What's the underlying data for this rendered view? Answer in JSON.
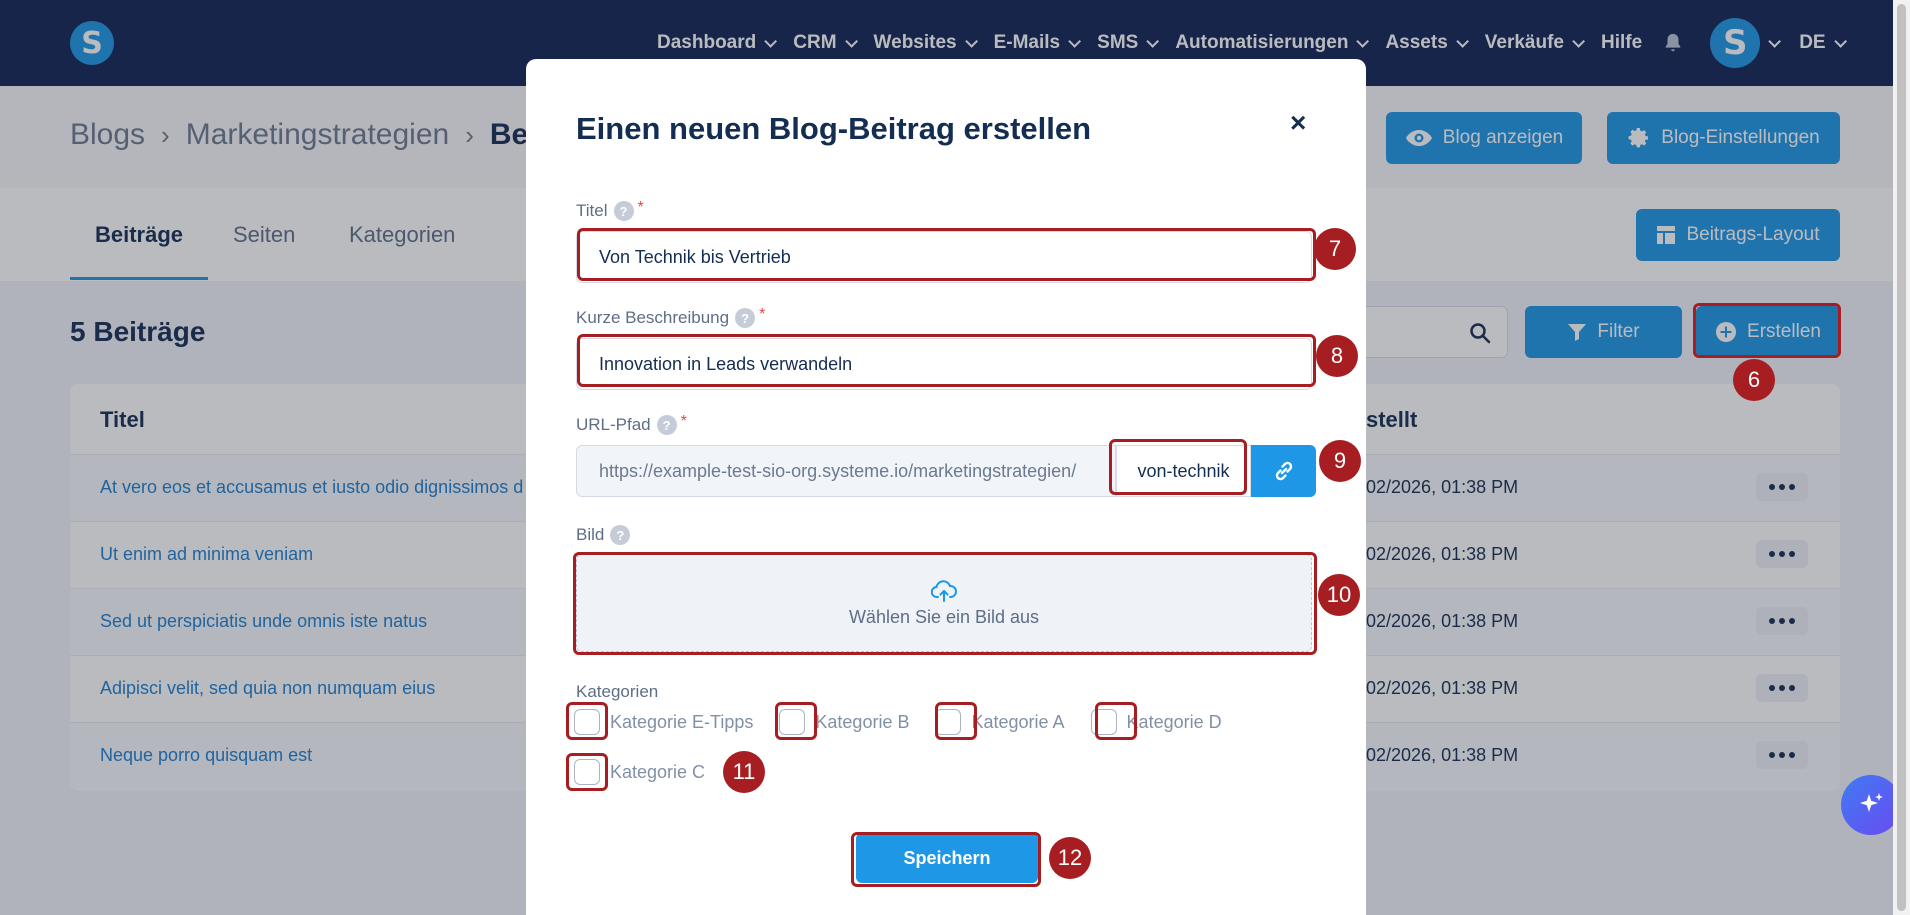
{
  "nav": {
    "items": [
      "Dashboard",
      "CRM",
      "Websites",
      "E-Mails",
      "SMS",
      "Automatisierungen",
      "Assets",
      "Verkäufe",
      "Hilfe"
    ],
    "has_chevron": [
      true,
      true,
      true,
      true,
      true,
      true,
      true,
      true,
      false
    ],
    "logo_letter": "S",
    "avatar_letter": "S",
    "language": "DE"
  },
  "breadcrumb": {
    "items": [
      "Blogs",
      "Marketingstrategien"
    ],
    "current": "Be"
  },
  "header_buttons": {
    "view_blog": "Blog anzeigen",
    "blog_settings": "Blog-Einstellungen",
    "post_layout": "Beitrags-Layout"
  },
  "tabs": [
    "Beiträge",
    "Seiten",
    "Kategorien"
  ],
  "list": {
    "count_title": "5 Beiträge",
    "filter_label": "Filter",
    "create_label": "Erstellen",
    "columns": {
      "title": "Titel",
      "created": "stellt"
    },
    "rows": [
      {
        "title": "At vero eos et accusamus et iusto odio dignissimos d",
        "date": "02/2026, 01:38 PM"
      },
      {
        "title": "Ut enim ad minima veniam",
        "date": "02/2026, 01:38 PM"
      },
      {
        "title": "Sed ut perspiciatis unde omnis iste natus",
        "date": "02/2026, 01:38 PM"
      },
      {
        "title": "Adipisci velit, sed quia non numquam eius",
        "date": "02/2026, 01:38 PM"
      },
      {
        "title": "Neque porro quisquam est",
        "date": "02/2026, 01:38 PM"
      }
    ]
  },
  "modal": {
    "title": "Einen neuen Blog-Beitrag erstellen",
    "close": "×",
    "title_label": "Titel",
    "title_value": "Von Technik bis Vertrieb",
    "desc_label": "Kurze Beschreibung",
    "desc_value": "Innovation in Leads verwandeln",
    "url_label": "URL-Pfad",
    "url_prefix": "https://example-test-sio-org.systeme.io/marketingstrategien/",
    "url_slug": "von-technik",
    "image_label": "Bild",
    "image_hint": "Wählen Sie ein Bild aus",
    "categories_label": "Kategorien",
    "categories": [
      "Kategorie E-Tipps",
      "Kategorie B",
      "Kategorie A",
      "Kategorie D",
      "Kategorie C"
    ],
    "save_label": "Speichern",
    "help": "?",
    "required": "*"
  },
  "annotations": [
    "6",
    "7",
    "8",
    "9",
    "10",
    "11",
    "12"
  ],
  "colors": {
    "nav_bg": "#0e2352",
    "accent": "#1d97e6",
    "highlight": "#a61e22",
    "text": "#142d52"
  }
}
